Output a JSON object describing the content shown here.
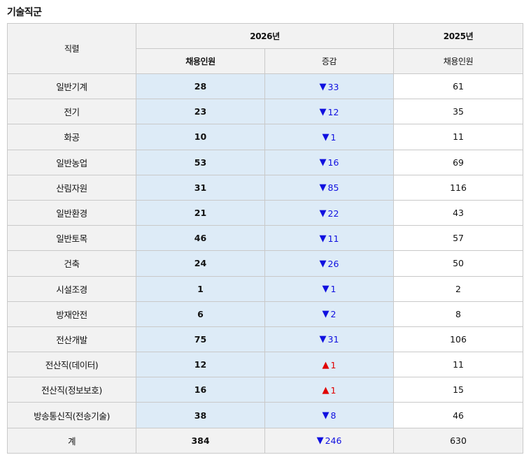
{
  "title": "기술직군",
  "header": {
    "job_col": "직렬",
    "year_2026": "2026년",
    "year_2025": "2025년",
    "hire_2026": "채용인원",
    "change": "증감",
    "hire_2025": "채용인원"
  },
  "symbols": {
    "down": "▼",
    "up": "▲"
  },
  "colors": {
    "down": "#1010e0",
    "up": "#e00000",
    "highlight": "#ddebf7"
  },
  "rows": [
    {
      "job": "일반기계",
      "h2026": "28",
      "dir": "down",
      "change": "33",
      "h2025": "61"
    },
    {
      "job": "전기",
      "h2026": "23",
      "dir": "down",
      "change": "12",
      "h2025": "35"
    },
    {
      "job": "화공",
      "h2026": "10",
      "dir": "down",
      "change": "1",
      "h2025": "11"
    },
    {
      "job": "일반농업",
      "h2026": "53",
      "dir": "down",
      "change": "16",
      "h2025": "69"
    },
    {
      "job": "산림자원",
      "h2026": "31",
      "dir": "down",
      "change": "85",
      "h2025": "116"
    },
    {
      "job": "일반환경",
      "h2026": "21",
      "dir": "down",
      "change": "22",
      "h2025": "43"
    },
    {
      "job": "일반토목",
      "h2026": "46",
      "dir": "down",
      "change": "11",
      "h2025": "57"
    },
    {
      "job": "건축",
      "h2026": "24",
      "dir": "down",
      "change": "26",
      "h2025": "50"
    },
    {
      "job": "시설조경",
      "h2026": "1",
      "dir": "down",
      "change": "1",
      "h2025": "2"
    },
    {
      "job": "방재안전",
      "h2026": "6",
      "dir": "down",
      "change": "2",
      "h2025": "8"
    },
    {
      "job": "전산개발",
      "h2026": "75",
      "dir": "down",
      "change": "31",
      "h2025": "106"
    },
    {
      "job": "전산직(데이터)",
      "h2026": "12",
      "dir": "up",
      "change": "1",
      "h2025": "11"
    },
    {
      "job": "전산직(정보보호)",
      "h2026": "16",
      "dir": "up",
      "change": "1",
      "h2025": "15"
    },
    {
      "job": "방송통신직(전송기술)",
      "h2026": "38",
      "dir": "down",
      "change": "8",
      "h2025": "46"
    }
  ],
  "total": {
    "job": "계",
    "h2026": "384",
    "dir": "down",
    "change": "246",
    "h2025": "630"
  }
}
